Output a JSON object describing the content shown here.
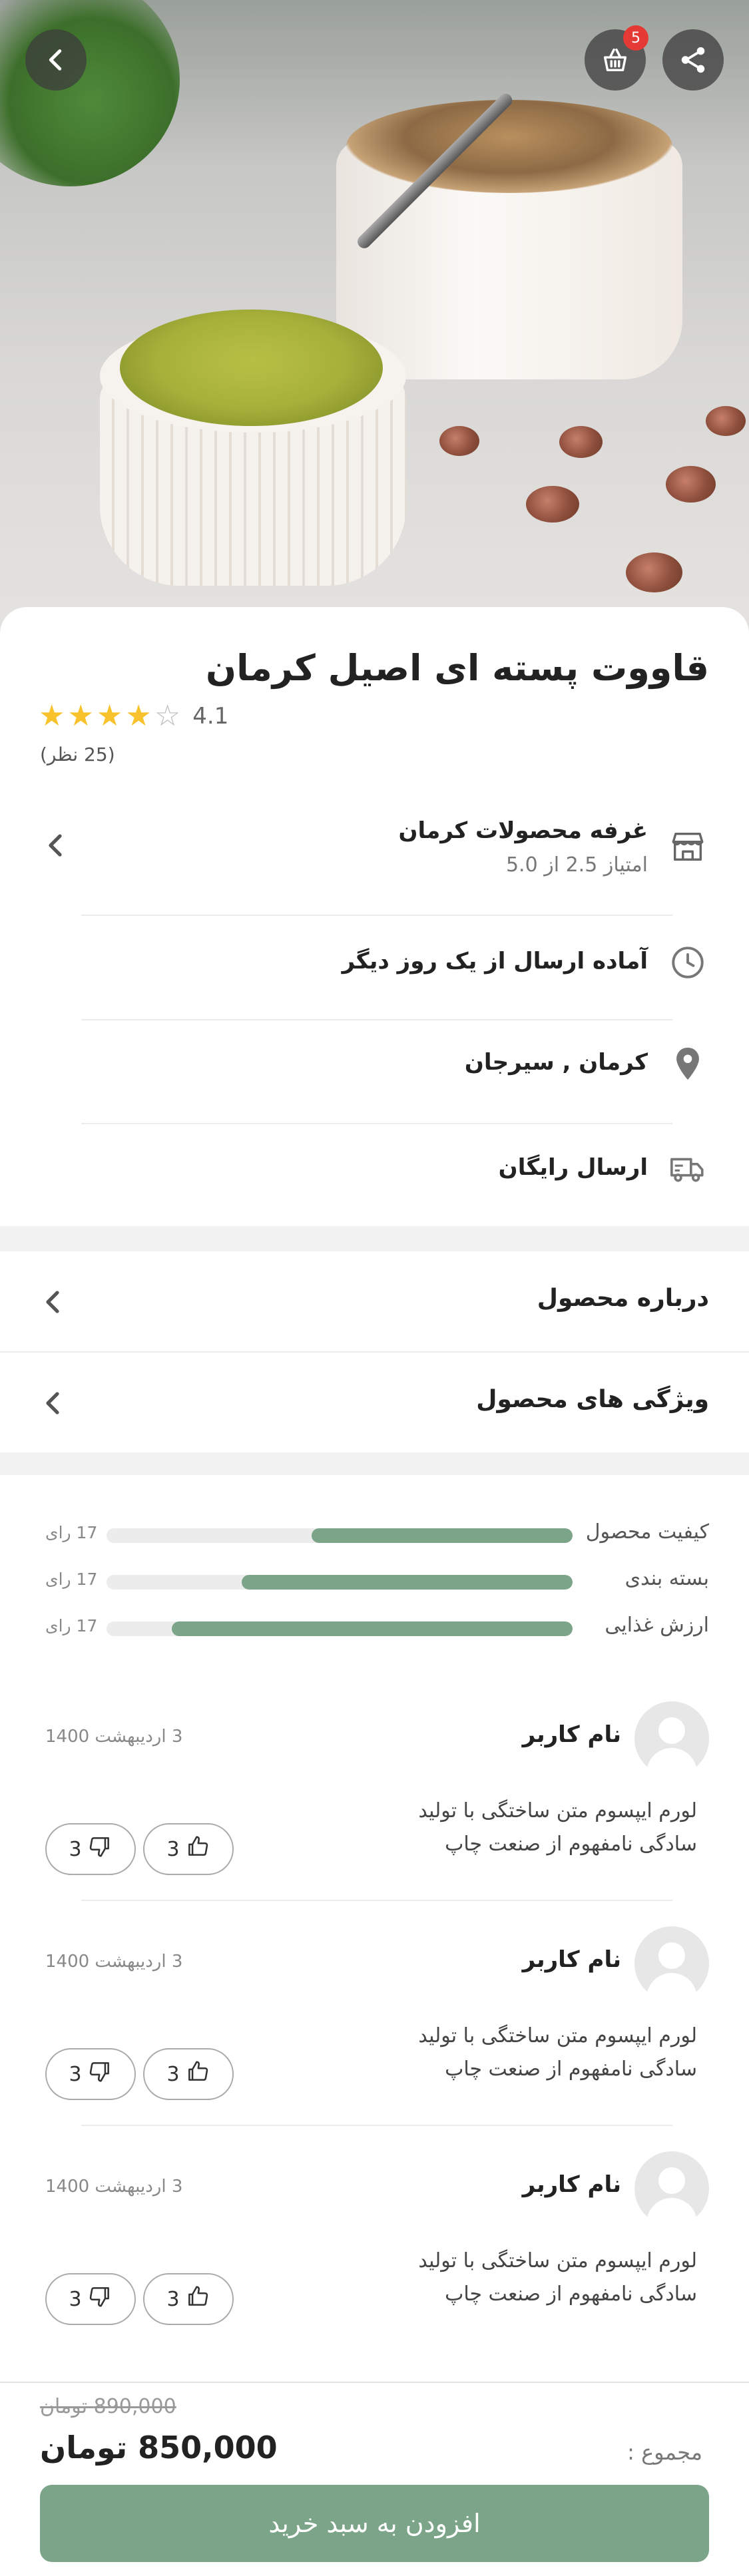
{
  "header": {
    "cart_count": "5"
  },
  "product": {
    "title": "قاووت پسته ای اصیل کرمان",
    "rating": "4.1",
    "rating_stars": 4,
    "reviews_count": "(25 نظر)"
  },
  "shop": {
    "name": "غرفه محصولات کرمان",
    "score": "امتیاز 2.5 از 5.0"
  },
  "info": {
    "shipping_time": "آماده ارسال از یک روز دیگر",
    "location": "کرمان , سیرجان",
    "shipping": "ارسال رایگان"
  },
  "sections": {
    "about": "درباره محصول",
    "features": "ویژگی های محصول"
  },
  "rating_bars": [
    {
      "label": "کیفیت محصول",
      "votes": "17 رای",
      "fraction": 0.56
    },
    {
      "label": "بسته بندی",
      "votes": "17 رای",
      "fraction": 0.71
    },
    {
      "label": "ارزش غذایی",
      "votes": "17 رای",
      "fraction": 0.86
    }
  ],
  "reviews": [
    {
      "name": "نام کاربر",
      "date": "3 اردیبهشت 1400",
      "text": "لورم ایپسوم متن ساختگی با تولید سادگی نامفهوم از صنعت چاپ",
      "likes": "3",
      "dislikes": "3"
    },
    {
      "name": "نام کاربر",
      "date": "3 اردیبهشت 1400",
      "text": "لورم ایپسوم متن ساختگی با تولید سادگی نامفهوم از صنعت چاپ",
      "likes": "3",
      "dislikes": "3"
    },
    {
      "name": "نام کاربر",
      "date": "3 اردیبهشت 1400",
      "text": "لورم ایپسوم متن ساختگی با تولید سادگی نامفهوم از صنعت چاپ",
      "likes": "3",
      "dislikes": "3"
    }
  ],
  "footer": {
    "old_price": "890,000 تومان",
    "new_price": "850,000 تومان",
    "total_label": "مجموع :",
    "add_to_cart": "افزودن به سبد خرید"
  },
  "colors": {
    "accent": "#7ba488",
    "star": "#f7c22b",
    "badge": "#e53935"
  },
  "icons": [
    "back-icon",
    "cart-icon",
    "share-icon",
    "store-icon",
    "clock-icon",
    "location-icon",
    "truck-icon",
    "chevron-left-icon",
    "thumbs-up-icon",
    "thumbs-down-icon"
  ]
}
